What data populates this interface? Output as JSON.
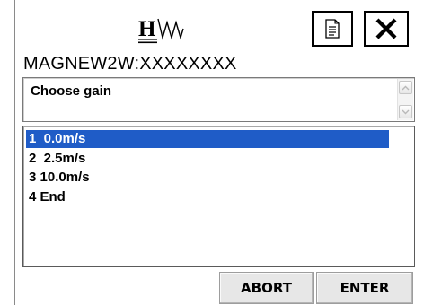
{
  "header": {
    "logo_icon": "hw-logo-icon",
    "document_icon": "document-icon",
    "close_icon": "close-icon"
  },
  "title": "MAGNEW2W:XXXXXXXX",
  "prompt": {
    "text": "Choose gain"
  },
  "list": {
    "items": [
      {
        "label": "1  0.0m/s",
        "selected": true
      },
      {
        "label": "2  2.5m/s",
        "selected": false
      },
      {
        "label": "3 10.0m/s",
        "selected": false
      },
      {
        "label": "4 End",
        "selected": false
      }
    ]
  },
  "buttons": {
    "abort": "ABORT",
    "enter": "ENTER"
  },
  "colors": {
    "selection": "#1f5cc7",
    "button_face": "#e7e7e7"
  }
}
